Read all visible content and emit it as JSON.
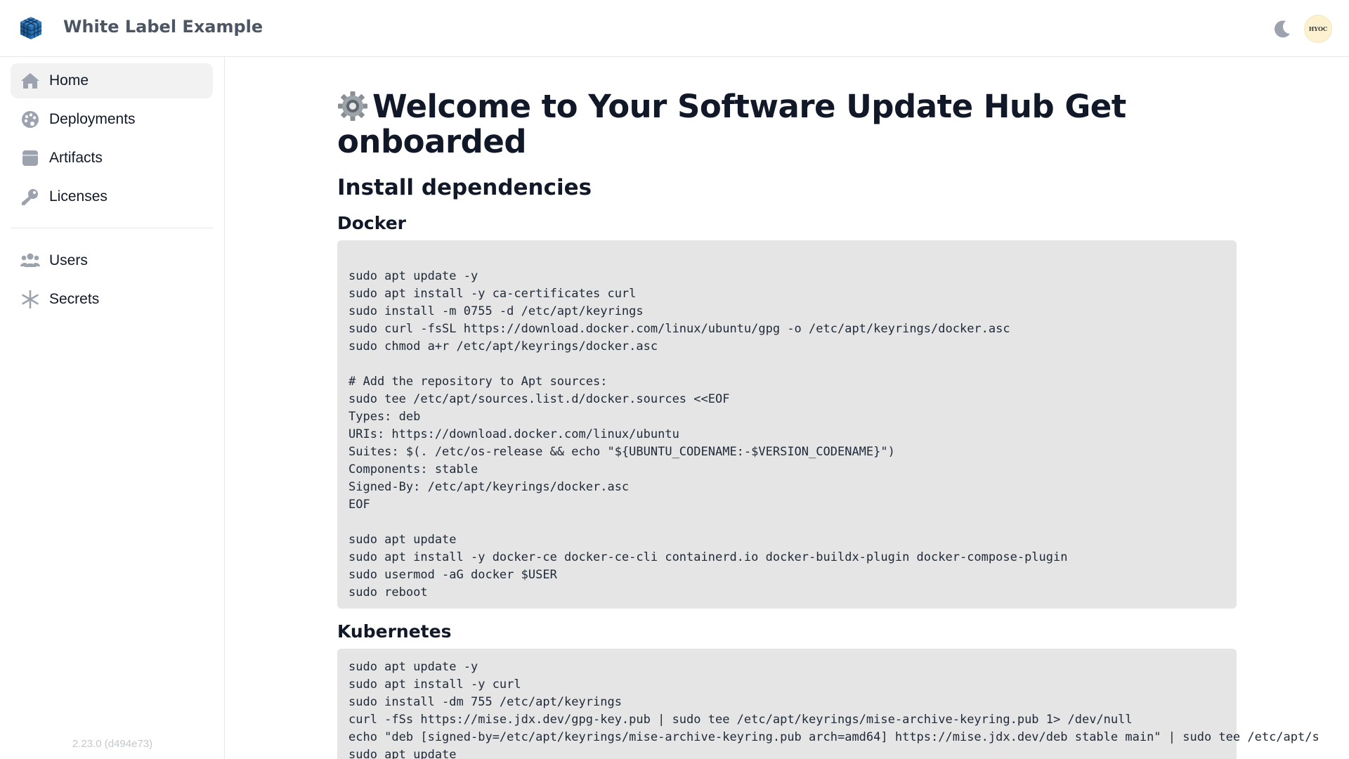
{
  "app": {
    "title": "White Label Example",
    "logo_icon": "cube-grid-logo-icon",
    "accent_color": "#2b6cb0"
  },
  "header": {
    "theme_toggle_icon": "moon-icon",
    "avatar_text": "HYOC"
  },
  "sidebar": {
    "items": [
      {
        "label": "Home",
        "icon": "home-icon",
        "active": true
      },
      {
        "label": "Deployments",
        "icon": "palette-icon",
        "active": false
      },
      {
        "label": "Artifacts",
        "icon": "box-icon",
        "active": false
      },
      {
        "label": "Licenses",
        "icon": "key-icon",
        "active": false
      },
      {
        "label": "Users",
        "icon": "users-icon",
        "active": false
      },
      {
        "label": "Secrets",
        "icon": "asterisk-icon",
        "active": false
      }
    ],
    "version": "2.23.0 (d494e73)"
  },
  "main": {
    "title": "Welcome to Your Software Update Hub Get onboarded",
    "title_icon": "gear-icon",
    "section_heading": "Install dependencies",
    "docker": {
      "heading": "Docker",
      "lines": [
        "",
        "sudo apt update -y",
        "sudo apt install -y ca-certificates curl",
        "sudo install -m 0755 -d /etc/apt/keyrings",
        "sudo curl -fsSL https://download.docker.com/linux/ubuntu/gpg -o /etc/apt/keyrings/docker.asc",
        "sudo chmod a+r /etc/apt/keyrings/docker.asc",
        "",
        "# Add the repository to Apt sources:",
        "sudo tee /etc/apt/sources.list.d/docker.sources <<EOF",
        "Types: deb",
        "URIs: https://download.docker.com/linux/ubuntu",
        "Suites: $(. /etc/os-release && echo \"${UBUNTU_CODENAME:-$VERSION_CODENAME}\")",
        "Components: stable",
        "Signed-By: /etc/apt/keyrings/docker.asc",
        "EOF",
        "",
        "sudo apt update",
        "sudo apt install -y docker-ce docker-ce-cli containerd.io docker-buildx-plugin docker-compose-plugin",
        "sudo usermod -aG docker $USER",
        "sudo reboot"
      ]
    },
    "kubernetes": {
      "heading": "Kubernetes",
      "lines": [
        "sudo apt update -y",
        "sudo apt install -y curl",
        "sudo install -dm 755 /etc/apt/keyrings",
        "curl -fSs https://mise.jdx.dev/gpg-key.pub | sudo tee /etc/apt/keyrings/mise-archive-keyring.pub 1> /dev/null",
        "echo \"deb [signed-by=/etc/apt/keyrings/mise-archive-keyring.pub arch=amd64] https://mise.jdx.dev/deb stable main\" | sudo tee /etc/apt/s",
        "sudo apt update"
      ]
    }
  }
}
